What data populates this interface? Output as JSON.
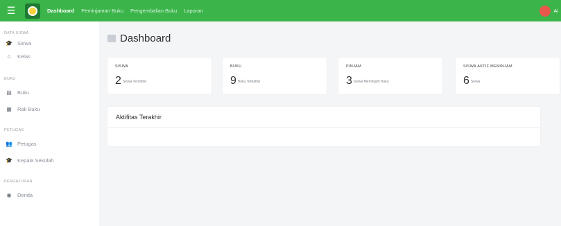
{
  "topbar": {
    "menu_icon": "hamburger-icon",
    "logo_icon": "emblem-logo",
    "nav": [
      "Dashboard",
      "Peminjaman Buku",
      "Pengembalian Buku",
      "Laporan"
    ],
    "active_index": 0,
    "user_initial": "",
    "user_name": "Ai",
    "brand_color": "#3bb54a"
  },
  "sidebar": {
    "sections": [
      {
        "title": "DATA SISWA",
        "items": [
          {
            "label": "Siswa",
            "icon": "graduation-cap-icon"
          },
          {
            "label": "Kelas",
            "icon": "home-icon"
          }
        ]
      },
      {
        "title": "BUKU",
        "items": [
          {
            "label": "Buku",
            "icon": "book-icon"
          },
          {
            "label": "Rak Buku",
            "icon": "shelf-icon"
          }
        ]
      },
      {
        "title": "PETUGAS",
        "items": [
          {
            "label": "Petugas",
            "icon": "users-icon"
          },
          {
            "label": "Kepala Sekolah",
            "icon": "graduation-cap-icon"
          }
        ]
      },
      {
        "title": "PENGATURAN",
        "items": [
          {
            "label": "Denda",
            "icon": "money-icon"
          }
        ]
      }
    ]
  },
  "main": {
    "title": "Dashboard",
    "cards": [
      {
        "label": "SISWA",
        "value": "2",
        "sub": "Siswa Terdaftar"
      },
      {
        "label": "BUKU",
        "value": "9",
        "sub": "Buku Terdaftar"
      },
      {
        "label": "PINJAM",
        "value": "3",
        "sub": "Siswa Meminjam Buku"
      },
      {
        "label": "SISWA AKTIF MEMINJAM",
        "value": "6",
        "sub": "Siswa"
      }
    ],
    "activity_title": "Aktifitas Terakhir"
  }
}
